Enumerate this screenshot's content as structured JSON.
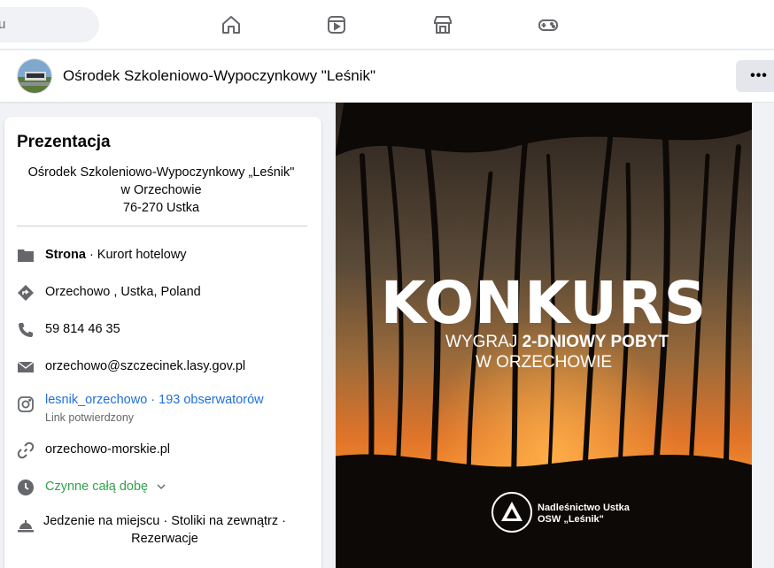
{
  "topnav": {
    "search_text": "u",
    "icons": [
      "home-icon",
      "video-icon",
      "marketplace-icon",
      "gaming-icon"
    ]
  },
  "page": {
    "name": "Ośrodek Szkoleniowo-Wypoczynkowy \"Leśnik\"",
    "more_label": "•••"
  },
  "intro": {
    "title": "Prezentacja",
    "bio_line1": "Ośrodek Szkoleniowo-Wypoczynkowy „Leśnik\"",
    "bio_line2": "w Orzechowie",
    "bio_line3": "76-270 Ustka",
    "category_label": "Strona",
    "category_value": " · Kurort hotelowy",
    "address": "Orzechowo , Ustka, Poland",
    "phone": "59 814 46 35",
    "email": "orzechowo@szczecinek.lasy.gov.pl",
    "instagram": "lesnik_orzechowo · 193 obserwatorów",
    "instagram_sub": "Link potwierdzony",
    "website": "orzechowo-morskie.pl",
    "hours": "Czynne całą dobę",
    "services_line1": "Jedzenie na miejscu · Stoliki na zewnątrz ·",
    "services_line2": "Rezerwacje"
  },
  "hero": {
    "headline": "KONKURS",
    "sub_pre": "WYGRAJ ",
    "sub_bold": "2-DNIOWY POBYT",
    "sub_line2": "W ORZECHOWIE",
    "org_line1": "Nadleśnictwo Ustka",
    "org_line2": "OSW „Leśnik\""
  },
  "colors": {
    "accent_blue": "#216fdb",
    "open_green": "#31a24c",
    "background": "#f0f2f5"
  }
}
